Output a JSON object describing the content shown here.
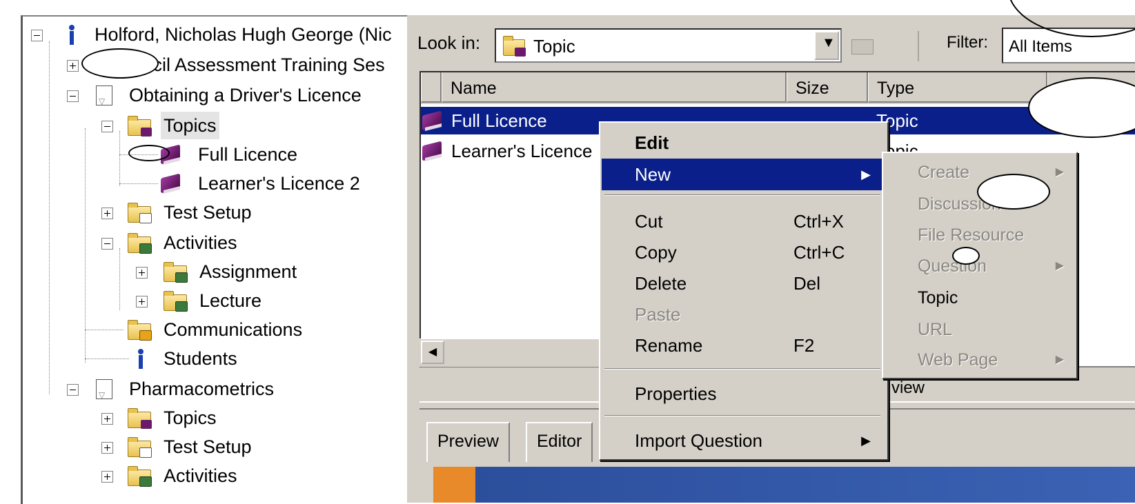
{
  "tree": {
    "root_user": "Holford, Nicholas Hugh George (Nic",
    "items": [
      {
        "label": "Cecil Assessment Training Ses"
      },
      {
        "label": "Obtaining a Driver's Licence"
      },
      {
        "label": "Topics"
      },
      {
        "label": "Full Licence"
      },
      {
        "label": "Learner's Licence 2"
      },
      {
        "label": "Test Setup"
      },
      {
        "label": "Activities"
      },
      {
        "label": "Assignment"
      },
      {
        "label": "Lecture"
      },
      {
        "label": "Communications"
      },
      {
        "label": "Students"
      },
      {
        "label": "Pharmacometrics"
      },
      {
        "label": "Topics"
      },
      {
        "label": "Test Setup"
      },
      {
        "label": "Activities"
      }
    ]
  },
  "toolbar": {
    "look_in_label": "Look in:",
    "look_in_value": "Topic",
    "filter_label": "Filter:",
    "filter_value": "All Items"
  },
  "list": {
    "columns": [
      "Name",
      "Size",
      "Type"
    ],
    "rows": [
      {
        "name": "Full Licence",
        "type": "Topic",
        "selected": true
      },
      {
        "name": "Learner's Licence",
        "type": "Topic",
        "selected": false
      }
    ]
  },
  "preview": {
    "caption": "view",
    "tabs": [
      "Preview",
      "Editor"
    ]
  },
  "context_menu": {
    "items": [
      {
        "label": "Edit",
        "shortcut": ""
      },
      {
        "label": "New",
        "shortcut": ""
      },
      {
        "label": "Cut",
        "shortcut": "Ctrl+X"
      },
      {
        "label": "Copy",
        "shortcut": "Ctrl+C"
      },
      {
        "label": "Delete",
        "shortcut": "Del"
      },
      {
        "label": "Paste",
        "shortcut": ""
      },
      {
        "label": "Rename",
        "shortcut": "F2"
      },
      {
        "label": "Properties",
        "shortcut": ""
      },
      {
        "label": "Import Question",
        "shortcut": ""
      }
    ]
  },
  "submenu": {
    "items": [
      {
        "label": "Create"
      },
      {
        "label": "Discussion"
      },
      {
        "label": "File Resource"
      },
      {
        "label": "Question"
      },
      {
        "label": "Topic"
      },
      {
        "label": "URL"
      },
      {
        "label": "Web Page"
      }
    ]
  },
  "colors": {
    "selection": "#0a1f8a",
    "window_bg": "#d4d0c8",
    "disabled_text": "#8a8780"
  }
}
